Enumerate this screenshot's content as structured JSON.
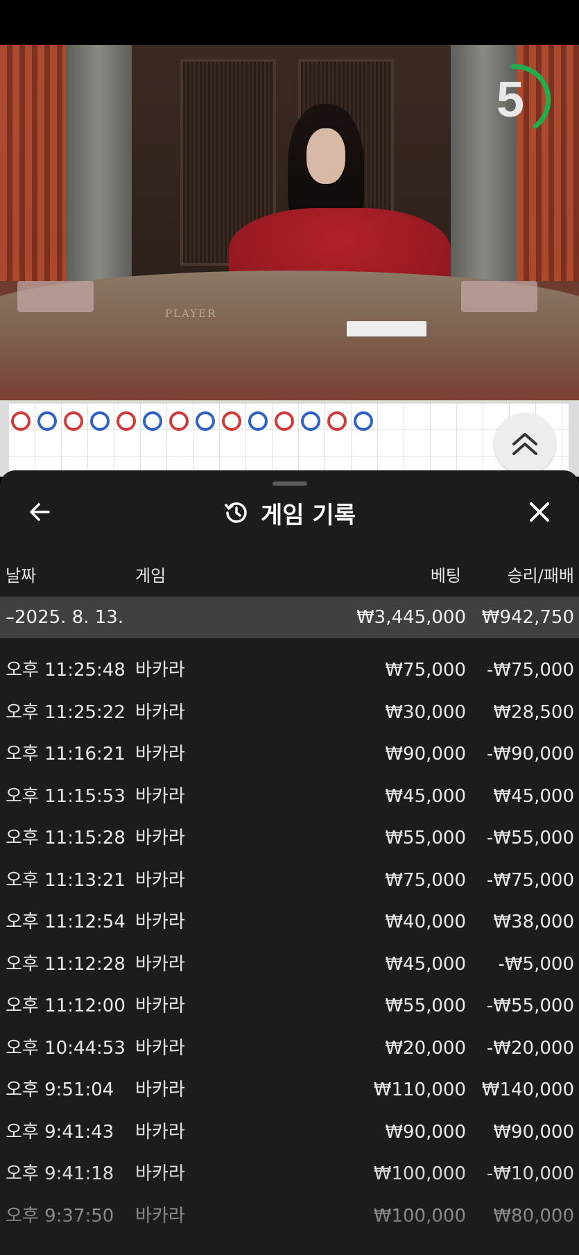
{
  "timer": {
    "seconds": "5",
    "accent": "#1fae4b"
  },
  "table_labels": {
    "player": "PLAYER"
  },
  "roadmap": {
    "row1": [
      "B",
      "P",
      "B",
      "P",
      "B",
      "P",
      "B",
      "P",
      "B",
      "P",
      "B",
      "P",
      "B",
      "P"
    ],
    "colors": {
      "banker": "#d23a3a",
      "player": "#2f62c8"
    }
  },
  "panel": {
    "title": "게임 기록",
    "back_icon": "arrow-left-icon",
    "history_icon": "history-clock-icon",
    "close_icon": "close-x-icon"
  },
  "columns": {
    "date": "날짜",
    "game": "게임",
    "bet": "베팅",
    "result": "승리/패배"
  },
  "date_group": {
    "label": "–2025. 8. 13.",
    "bet_total": "₩3,445,000",
    "result_total": "₩942,750"
  },
  "rows": [
    {
      "time": "오후 11:25:48",
      "game": "바카라",
      "bet": "₩75,000",
      "result": "-₩75,000"
    },
    {
      "time": "오후 11:25:22",
      "game": "바카라",
      "bet": "₩30,000",
      "result": "₩28,500"
    },
    {
      "time": "오후 11:16:21",
      "game": "바카라",
      "bet": "₩90,000",
      "result": "-₩90,000"
    },
    {
      "time": "오후 11:15:53",
      "game": "바카라",
      "bet": "₩45,000",
      "result": "₩45,000"
    },
    {
      "time": "오후 11:15:28",
      "game": "바카라",
      "bet": "₩55,000",
      "result": "-₩55,000"
    },
    {
      "time": "오후 11:13:21",
      "game": "바카라",
      "bet": "₩75,000",
      "result": "-₩75,000"
    },
    {
      "time": "오후 11:12:54",
      "game": "바카라",
      "bet": "₩40,000",
      "result": "₩38,000"
    },
    {
      "time": "오후 11:12:28",
      "game": "바카라",
      "bet": "₩45,000",
      "result": "-₩5,000"
    },
    {
      "time": "오후 11:12:00",
      "game": "바카라",
      "bet": "₩55,000",
      "result": "-₩55,000"
    },
    {
      "time": "오후 10:44:53",
      "game": "바카라",
      "bet": "₩20,000",
      "result": "-₩20,000"
    },
    {
      "time": "오후 9:51:04",
      "game": "바카라",
      "bet": "₩110,000",
      "result": "₩140,000"
    },
    {
      "time": "오후 9:41:43",
      "game": "바카라",
      "bet": "₩90,000",
      "result": "₩90,000"
    },
    {
      "time": "오후 9:41:18",
      "game": "바카라",
      "bet": "₩100,000",
      "result": "-₩10,000"
    },
    {
      "time": "오후 9:37:50",
      "game": "바카라",
      "bet": "₩100,000",
      "result": "₩80,000"
    }
  ]
}
